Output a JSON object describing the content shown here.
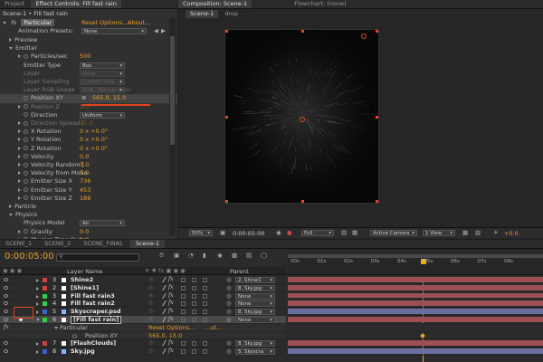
{
  "top_tabs": {
    "project": "Project",
    "effect_controls": "Effect Controls: Fill fast rain",
    "composition": "Composition: Scene-1",
    "flowchart": "Flowchart: (none)"
  },
  "effect_controls": {
    "breadcrumb": "Scene-1 • Fill fast rain",
    "effect_name": "Particular",
    "reset": "Reset",
    "options": "Options...",
    "about": "About...",
    "animation_presets_label": "Animation Presets:",
    "animation_presets_value": "None",
    "props": [
      {
        "indent": 1,
        "tri": "right",
        "label": "Preview"
      },
      {
        "indent": 1,
        "tri": "down",
        "label": "Emitter"
      },
      {
        "indent": 2,
        "tri": "right",
        "sw": true,
        "label": "Particles/sec",
        "value": "500"
      },
      {
        "indent": 2,
        "label": "Emitter Type",
        "dropdown": "Box"
      },
      {
        "indent": 2,
        "label": "Layer",
        "dropdown": "None",
        "dim": true
      },
      {
        "indent": 2,
        "label": "Layer Sampling",
        "dropdown": "Current Time",
        "dim": true
      },
      {
        "indent": 2,
        "label": "Layer RGB Usage",
        "dropdown": "RGB - Particle Color",
        "dim": true
      },
      {
        "indent": 2,
        "sw": true,
        "label": "Position XY",
        "value": "565.0, 15.0",
        "highlight": true
      },
      {
        "indent": 2,
        "tri": "right",
        "sw": true,
        "label": "Position Z",
        "value": "0.0",
        "dim": true
      },
      {
        "indent": 2,
        "sw": true,
        "label": "Direction",
        "dropdown": "Uniform"
      },
      {
        "indent": 2,
        "tri": "right",
        "sw": true,
        "label": "Direction Spread [",
        "value": "20.0",
        "dim": true
      },
      {
        "indent": 2,
        "tri": "right",
        "sw": true,
        "label": "X Rotation",
        "value": "0 x +0.0°"
      },
      {
        "indent": 2,
        "tri": "right",
        "sw": true,
        "label": "Y Rotation",
        "value": "0 x +0.0°"
      },
      {
        "indent": 2,
        "tri": "right",
        "sw": true,
        "label": "Z Rotation",
        "value": "0 x +0.0°"
      },
      {
        "indent": 2,
        "tri": "right",
        "sw": true,
        "label": "Velocity",
        "value": "0.0"
      },
      {
        "indent": 2,
        "tri": "right",
        "sw": true,
        "label": "Velocity Random [",
        "value": "5.0"
      },
      {
        "indent": 2,
        "tri": "right",
        "sw": true,
        "label": "Velocity from Motio",
        "value": "5.0"
      },
      {
        "indent": 2,
        "tri": "right",
        "sw": true,
        "label": "Emitter Size X",
        "value": "736"
      },
      {
        "indent": 2,
        "tri": "right",
        "sw": true,
        "label": "Emitter Size Y",
        "value": "453"
      },
      {
        "indent": 2,
        "tri": "right",
        "sw": true,
        "label": "Emitter Size Z",
        "value": "188"
      },
      {
        "indent": 1,
        "tri": "right",
        "label": "Particle"
      },
      {
        "indent": 1,
        "tri": "down",
        "label": "Physics"
      },
      {
        "indent": 2,
        "label": "Physics Model",
        "dropdown": "Air"
      },
      {
        "indent": 2,
        "tri": "right",
        "sw": true,
        "label": "Gravity",
        "value": "0.0"
      },
      {
        "indent": 2,
        "tri": "right",
        "sw": true,
        "label": "Physics Time Facto",
        "value": "1.0"
      }
    ]
  },
  "composition": {
    "sub_tab": "Scene-1",
    "drop_label": "drop",
    "zoom": "50%",
    "timecode": "0:00:05:00",
    "resolution": "Full",
    "camera": "Active Camera",
    "view": "1 View",
    "exposure": "+0.0"
  },
  "timeline": {
    "tabs": [
      "SCENE_1",
      "SCENE_2",
      "SCENE_FINAL",
      "Scene-1"
    ],
    "active_tab": 3,
    "timecode": "0:00:05:00",
    "search_placeholder": "",
    "col_layer_name": "Layer Name",
    "col_parent": "Parent",
    "ruler": [
      "00s",
      "01s",
      "02s",
      "03s",
      "04s",
      "05s",
      "06s",
      "07s",
      "08s"
    ],
    "layers": [
      {
        "num": "3",
        "color": "#d2403a",
        "name": "Shine2",
        "parent": "2. Shine1",
        "bar": "red"
      },
      {
        "num": "2",
        "color": "#d2403a",
        "name": "[Shine1]",
        "parent": "8. Sky.jpg",
        "bar": "red"
      },
      {
        "num": "3",
        "color": "#2fd14a",
        "name": "Fill fast rain3",
        "parent": "None",
        "bar": "red"
      },
      {
        "num": "4",
        "color": "#2fd14a",
        "name": "Fill fast rain2",
        "parent": "None",
        "bar": "red"
      },
      {
        "num": "5",
        "color": "#3b5fd4",
        "name": "Skyscraper.psd",
        "parent": "8. Sky.jpg",
        "bar": "blue"
      },
      {
        "num": "6",
        "color": "#2fd14a",
        "name": "[Fill fast rain]",
        "parent": "None",
        "bar": "red",
        "selected": true
      }
    ],
    "sub_effect": "Particular",
    "sub_reset": "Reset",
    "sub_options": "Options...",
    "sub_about": "...ut...",
    "sub_prop": "Position XY",
    "sub_prop_value": "565.0, 15.0",
    "layers_after": [
      {
        "num": "7",
        "color": "#d2403a",
        "name": "[FlashClouds]",
        "parent": "8. Sky.jpg",
        "bar": "red"
      },
      {
        "num": "8",
        "color": "#3b5fd4",
        "name": "Sky.jpg",
        "parent": "5. Skyscra",
        "bar": "blue"
      }
    ]
  }
}
